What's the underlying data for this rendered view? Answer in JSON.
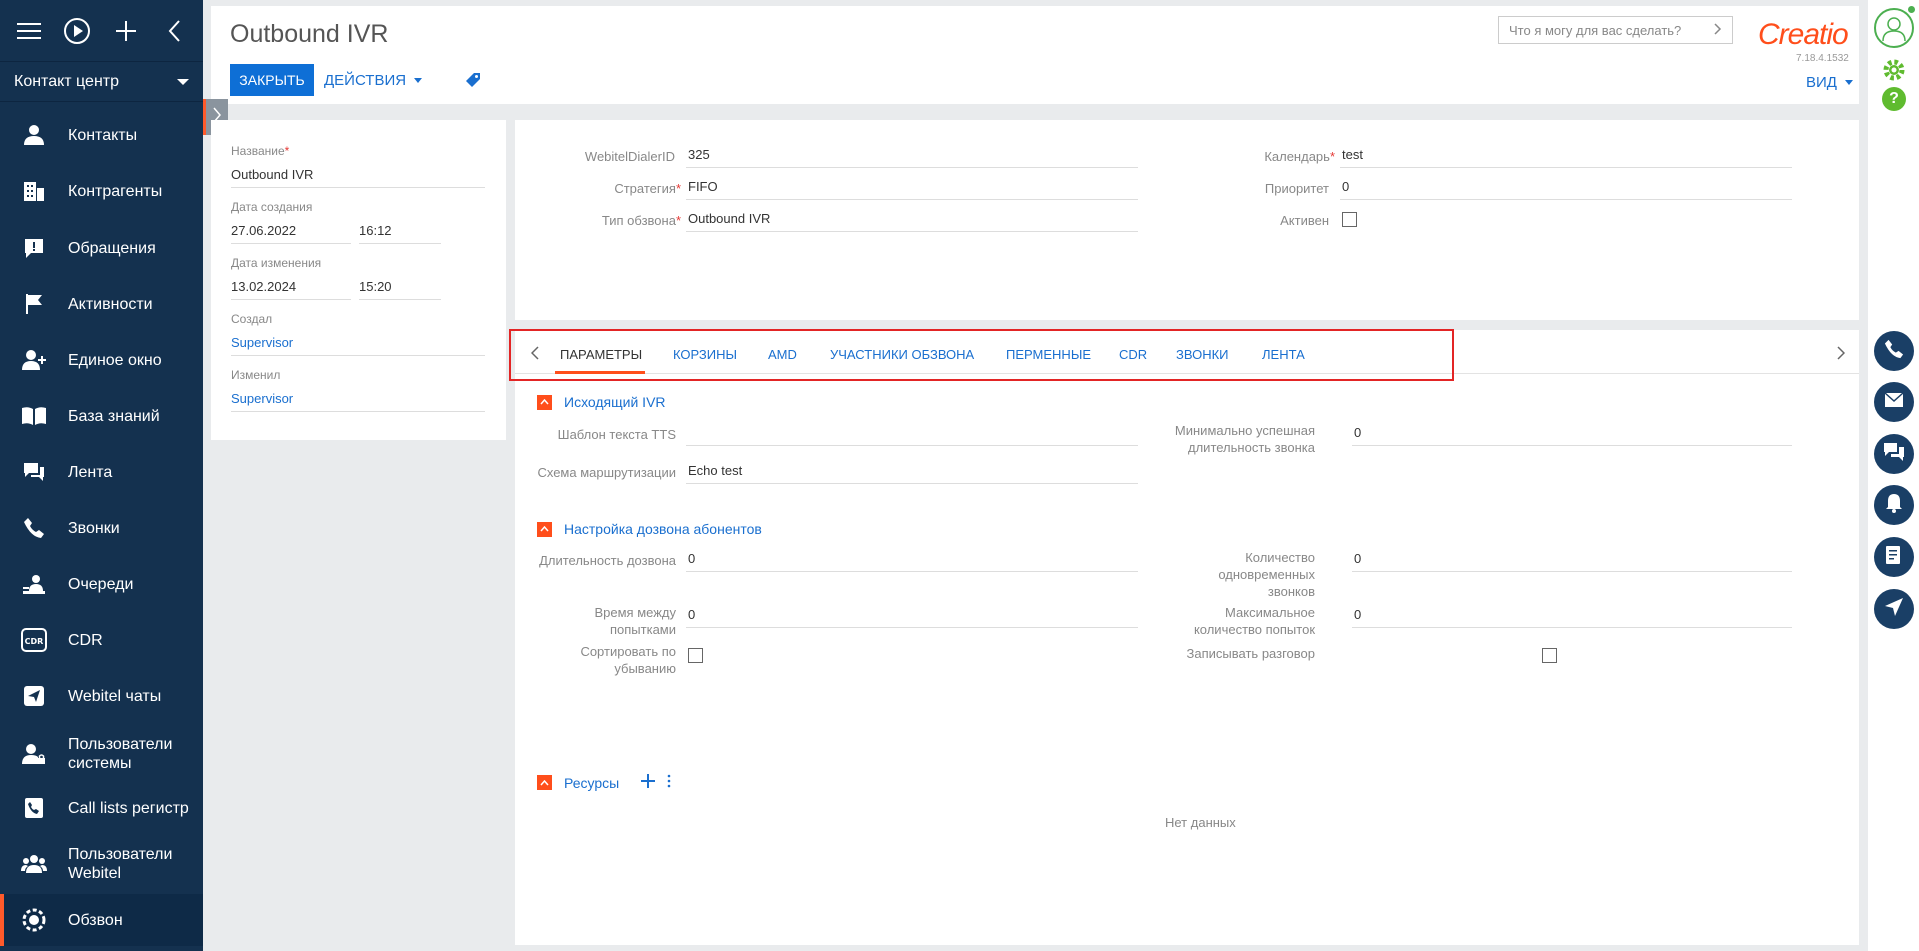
{
  "sidebar": {
    "workspace": "Контакт центр",
    "items": [
      {
        "label": "Контакты",
        "icon": "person-icon"
      },
      {
        "label": "Контрагенты",
        "icon": "building-icon"
      },
      {
        "label": "Обращения",
        "icon": "alert-card-icon"
      },
      {
        "label": "Активности",
        "icon": "flag-icon"
      },
      {
        "label": "Единое окно",
        "icon": "person-plus-icon"
      },
      {
        "label": "База знаний",
        "icon": "book-icon"
      },
      {
        "label": "Лента",
        "icon": "feed-icon"
      },
      {
        "label": "Звонки",
        "icon": "phone-icon"
      },
      {
        "label": "Очереди",
        "icon": "queue-person-icon"
      },
      {
        "label": "CDR",
        "icon": "cdr-icon"
      },
      {
        "label": "Webitel чаты",
        "icon": "send-icon"
      },
      {
        "label": "Пользователи системы",
        "icon": "user-lock-icon"
      },
      {
        "label": "Call lists регистр",
        "icon": "call-list-icon"
      },
      {
        "label": "Пользователи Webitel",
        "icon": "users-group-icon"
      },
      {
        "label": "Обзвон",
        "icon": "dialer-gear-icon"
      }
    ]
  },
  "header": {
    "title": "Outbound IVR",
    "close_label": "ЗАКРЫТЬ",
    "actions_label": "ДЕЙСТВИЯ",
    "search_placeholder": "Что я могу для вас сделать?",
    "logo": "Creatio",
    "version": "7.18.4.1532",
    "view_label": "ВИД"
  },
  "left_card": {
    "name_label": "Название",
    "name_value": "Outbound IVR",
    "created_label": "Дата создания",
    "created_date": "27.06.2022",
    "created_time": "16:12",
    "modified_label": "Дата изменения",
    "modified_date": "13.02.2024",
    "modified_time": "15:20",
    "creator_label": "Создал",
    "creator_value": "Supervisor",
    "modifier_label": "Изменил",
    "modifier_value": "Supervisor"
  },
  "top_card": {
    "dialer_id_label": "WebitelDialerID",
    "dialer_id_value": "325",
    "strategy_label": "Стратегия",
    "strategy_value": "FIFO",
    "type_label": "Тип обзвона",
    "type_value": "Outbound IVR",
    "calendar_label": "Календарь",
    "calendar_value": "test",
    "priority_label": "Приоритет",
    "priority_value": "0",
    "active_label": "Активен"
  },
  "tabs": [
    {
      "label": "ПАРАМЕТРЫ"
    },
    {
      "label": "КОРЗИНЫ"
    },
    {
      "label": "AMD"
    },
    {
      "label": "УЧАСТНИКИ ОБЗВОНА"
    },
    {
      "label": "ПЕРМЕННЫЕ"
    },
    {
      "label": "CDR"
    },
    {
      "label": "ЗВОНКИ"
    },
    {
      "label": "ЛЕНТА"
    }
  ],
  "ivr_group": {
    "title": "Исходящий IVR",
    "tts_label": "Шаблон текста TTS",
    "tts_value": "",
    "routing_label": "Схема маршрутизации",
    "routing_value": "Echo test",
    "min_duration_label_1": "Минимально успешная",
    "min_duration_label_2": "длительность звонка",
    "min_duration_value": "0"
  },
  "dial_group": {
    "title": "Настройка дозвона абонентов",
    "dial_duration_label": "Длительность дозвона",
    "dial_duration_value": "0",
    "retry_interval_label_1": "Время между",
    "retry_interval_label_2": "попытками",
    "retry_interval_value": "0",
    "sort_desc_label_1": "Сортировать по",
    "sort_desc_label_2": "убыванию",
    "concurrent_label_1": "Количество",
    "concurrent_label_2": "одновременных",
    "concurrent_label_3": "звонков",
    "concurrent_value": "0",
    "max_attempts_label_1": "Максимальное",
    "max_attempts_label_2": "количество попыток",
    "max_attempts_value": "0",
    "record_label": "Записывать разговор"
  },
  "resources_group": {
    "title": "Ресурсы",
    "empty": "Нет данных"
  },
  "colors": {
    "sidebar": "#14314f",
    "accent": "#ff4e1b",
    "link": "#1a6fcf",
    "primary_button": "#0e6fd6",
    "highlight_border": "#e32525"
  }
}
